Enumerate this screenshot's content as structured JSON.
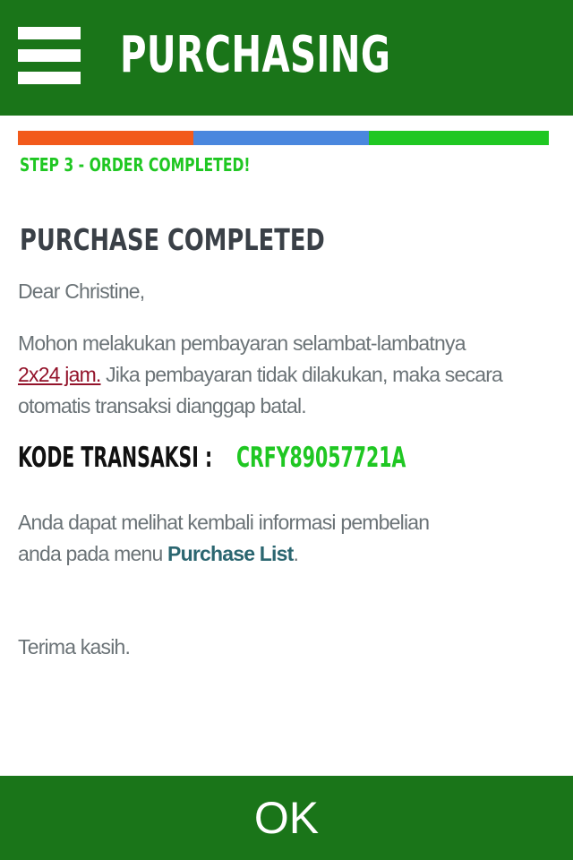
{
  "header": {
    "title": "PURCHASING",
    "menu_icon": "hamburger-menu-icon"
  },
  "progress": {
    "current_step": 3,
    "total_steps": 3,
    "segment_colors": [
      "#f25a1b",
      "#4a87de",
      "#1fc722"
    ]
  },
  "step_label": "STEP 3 - ORDER COMPLETED!",
  "colors": {
    "header_bg": "#1a7519",
    "step_label": "#1fc722",
    "transaction_code": "#1fc722",
    "deadline_link": "#93132a",
    "purchase_list_link": "#2b6670"
  },
  "content": {
    "section_title": "PURCHASE COMPLETED",
    "greeting": "Dear Christine,",
    "payment_intro": "Mohon melakukan pembayaran selambat-lambatnya",
    "payment_deadline": "2x24 jam.",
    "payment_warning_line1": " Jika pembayaran tidak dilakukan, maka secara",
    "payment_warning_line2": "otomatis transaksi dianggap batal.",
    "transaction_code_label": "KODE TRANSAKSI :",
    "transaction_code": "CRFY89057721A",
    "info_line1": "Anda dapat melihat kembali informasi pembelian",
    "info_line2": "anda pada menu ",
    "purchase_list_link": "Purchase List",
    "info_end": ".",
    "closing": "Terima kasih."
  },
  "footer": {
    "ok_label": "OK"
  }
}
